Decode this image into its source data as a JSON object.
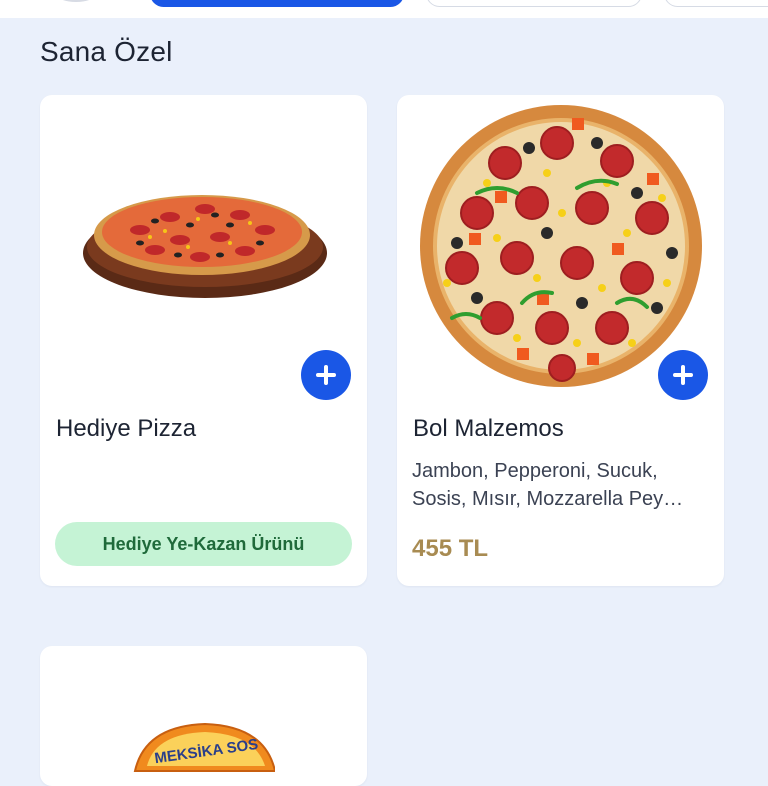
{
  "section": {
    "title": "Sana Özel"
  },
  "products": [
    {
      "title": "Hediye Pizza",
      "badge": "Hediye Ye-Kazan Ürünü",
      "image_icon": "pizza-on-board"
    },
    {
      "title": "Bol Malzemos",
      "description_line1": "Jambon, Pepperoni, Sucuk,",
      "description_line2": "Sosis, Mısır, Mozzarella Pey…",
      "price": "455 TL",
      "image_icon": "pizza-top-view"
    },
    {
      "image_icon": "sauce-package",
      "image_text": "MEKSİKA SOS"
    }
  ],
  "colors": {
    "accent": "#1a57e6",
    "background": "#eaf0fb",
    "price": "#a88b52",
    "badge_bg": "#c5f3d5",
    "badge_text": "#1f6a3a"
  }
}
